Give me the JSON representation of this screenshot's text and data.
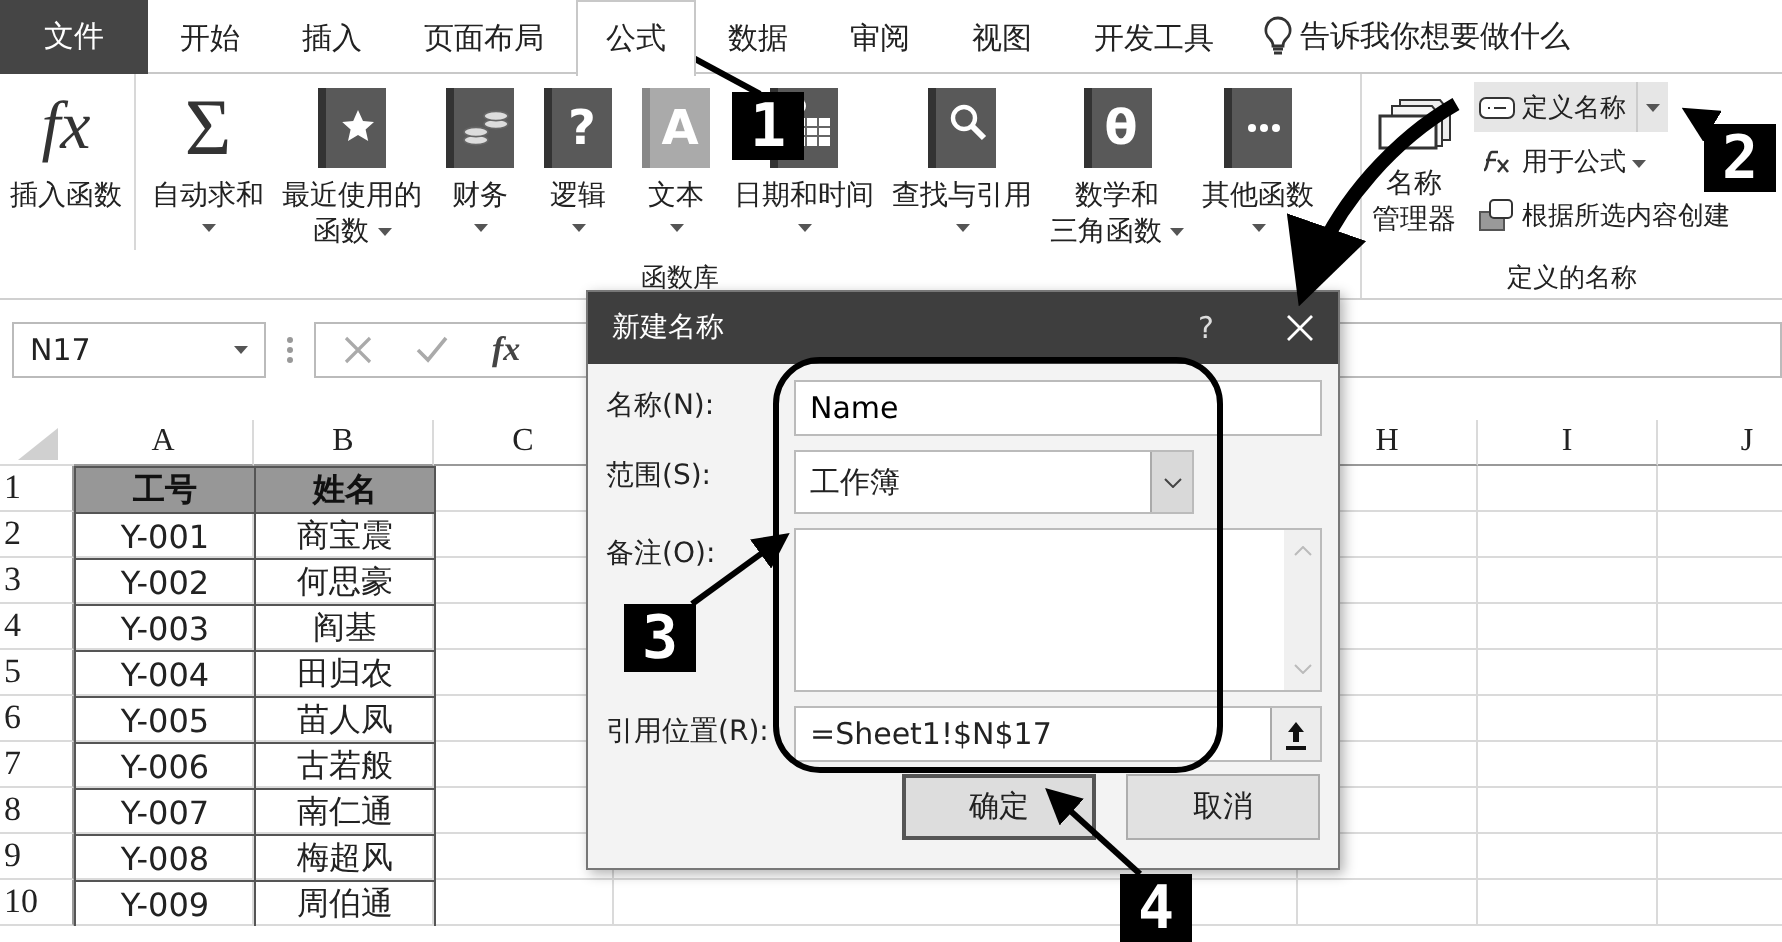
{
  "tabs": [
    {
      "label": "文件",
      "kind": "file",
      "selected": false
    },
    {
      "label": "开始",
      "kind": "tab",
      "selected": false
    },
    {
      "label": "插入",
      "kind": "tab",
      "selected": false
    },
    {
      "label": "页面布局",
      "kind": "tab",
      "selected": false
    },
    {
      "label": "公式",
      "kind": "tab",
      "selected": true
    },
    {
      "label": "数据",
      "kind": "tab",
      "selected": false
    },
    {
      "label": "审阅",
      "kind": "tab",
      "selected": false
    },
    {
      "label": "视图",
      "kind": "tab",
      "selected": false
    },
    {
      "label": "开发工具",
      "kind": "tab",
      "selected": false
    }
  ],
  "tell_me": "告诉我你想要做什么",
  "function_library": {
    "label": "函数库",
    "buttons": [
      {
        "lines": [
          "插入函数"
        ],
        "kind": "symbol",
        "glyph": "fx",
        "dropdown": false
      },
      {
        "lines": [
          "自动求和"
        ],
        "kind": "symbol",
        "glyph": "Σ",
        "dropdown": true
      },
      {
        "lines": [
          "最近使用的",
          "函数"
        ],
        "kind": "book",
        "dropdown": true
      },
      {
        "lines": [
          "财务"
        ],
        "kind": "book",
        "dropdown": true
      },
      {
        "lines": [
          "逻辑"
        ],
        "kind": "book",
        "glyph": "?",
        "dropdown": true
      },
      {
        "lines": [
          "文本"
        ],
        "kind": "book",
        "glyph": "A",
        "dropdown": true
      },
      {
        "lines": [
          "日期和时间"
        ],
        "kind": "book",
        "dropdown": true
      },
      {
        "lines": [
          "查找与引用"
        ],
        "kind": "book",
        "dropdown": true
      },
      {
        "lines": [
          "数学和",
          "三角函数"
        ],
        "kind": "book",
        "glyph": "θ",
        "dropdown": true
      },
      {
        "lines": [
          "其他函数"
        ],
        "kind": "book",
        "dropdown": true
      }
    ]
  },
  "defined_names": {
    "label": "定义的名称",
    "manager": [
      "名称",
      "管理器"
    ],
    "items": [
      {
        "label": "定义名称",
        "dropdown": true,
        "highlighted": true
      },
      {
        "label": "用于公式",
        "dropdown": true,
        "highlighted": false
      },
      {
        "label": "根据所选内容创建",
        "dropdown": false,
        "highlighted": false
      }
    ]
  },
  "formula_bar": {
    "name_box": "N17",
    "fx": "fx"
  },
  "sheet": {
    "columns": [
      "A",
      "B",
      "C",
      "H",
      "I",
      "J"
    ],
    "rows": [
      {
        "number": "1",
        "kind": "header",
        "cells": [
          "工号",
          "姓名"
        ]
      },
      {
        "number": "2",
        "kind": "data",
        "cells": [
          "Y-001",
          "商宝震"
        ]
      },
      {
        "number": "3",
        "kind": "data",
        "cells": [
          "Y-002",
          "何思豪"
        ]
      },
      {
        "number": "4",
        "kind": "data",
        "cells": [
          "Y-003",
          "阎基"
        ]
      },
      {
        "number": "5",
        "kind": "data",
        "cells": [
          "Y-004",
          "田归农"
        ]
      },
      {
        "number": "6",
        "kind": "data",
        "cells": [
          "Y-005",
          "苗人凤"
        ]
      },
      {
        "number": "7",
        "kind": "data",
        "cells": [
          "Y-006",
          "古若般"
        ]
      },
      {
        "number": "8",
        "kind": "data",
        "cells": [
          "Y-007",
          "南仁通"
        ]
      },
      {
        "number": "9",
        "kind": "data",
        "cells": [
          "Y-008",
          "梅超风"
        ]
      },
      {
        "number": "10",
        "kind": "data",
        "cells": [
          "Y-009",
          "周伯通"
        ]
      }
    ]
  },
  "dialog": {
    "title": "新建名称",
    "help": "?",
    "name_label": "名称(N):",
    "name_value": "Name",
    "scope_label": "范围(S):",
    "scope_value": "工作簿",
    "comment_label": "备注(O):",
    "refers_label": "引用位置(R):",
    "refers_value": "=Sheet1!$N$17",
    "buttons": [
      {
        "label": "确定",
        "default": true
      },
      {
        "label": "取消",
        "default": false
      }
    ]
  },
  "callouts": [
    {
      "label": "1"
    },
    {
      "label": "2"
    },
    {
      "label": "3"
    },
    {
      "label": "4"
    }
  ]
}
